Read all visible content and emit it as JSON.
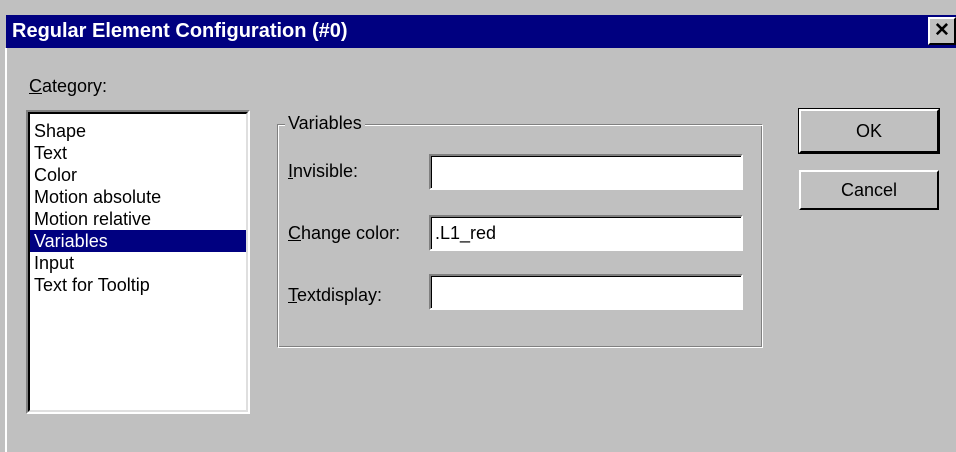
{
  "window": {
    "title": "Regular Element Configuration (#0)",
    "close_glyph": "✕"
  },
  "category": {
    "label_underlined": "C",
    "label_rest": "ategory:",
    "items": [
      "Shape",
      "Text",
      "Color",
      "Motion absolute",
      "Motion relative",
      "Variables",
      "Input",
      "Text for Tooltip"
    ],
    "selected": "Variables"
  },
  "variables_group": {
    "title": "Variables",
    "fields": [
      {
        "label_underlined": "I",
        "label_rest": "nvisible:",
        "value": ""
      },
      {
        "label_underlined": "C",
        "label_rest": "hange color:",
        "value": ".L1_red"
      },
      {
        "label_underlined": "T",
        "label_rest": "extdisplay:",
        "value": ""
      }
    ]
  },
  "buttons": {
    "ok": "OK",
    "cancel": "Cancel"
  }
}
